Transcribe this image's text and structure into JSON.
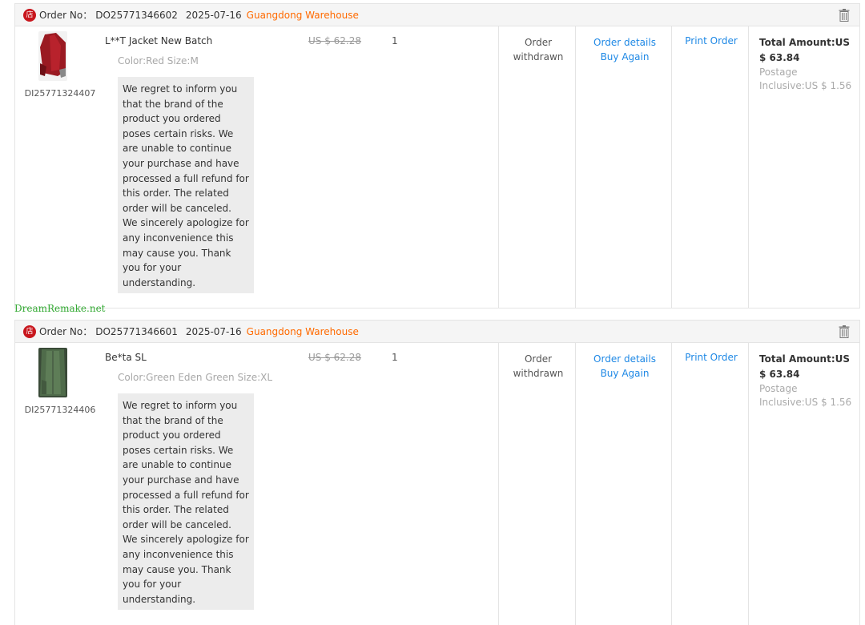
{
  "colors": {
    "warehouse": "#ff6a00",
    "link": "#1e88e5",
    "shop_icon": "#c8161d",
    "watermark": "#33aa33"
  },
  "watermark": "DreamRemake.net",
  "orders": [
    {
      "shop_icon_glyph": "店",
      "order_label": "Order No：",
      "order_no": "DO25771346602",
      "date": "2025-07-16",
      "warehouse": "Guangdong Warehouse",
      "thumb_icon": "red-jacket-icon",
      "item_code": "DI25771324407",
      "product_name": "L**T Jacket New Batch",
      "product_spec": "Color:Red Size:M",
      "refund_note": "We regret to inform you that the brand of the product you ordered poses certain risks. We are unable to continue your purchase and have processed a full refund for this order. The related order will be canceled. We sincerely apologize for any inconvenience this may cause you. Thank you for your understanding.",
      "price": "US $ 62.28",
      "qty": "1",
      "status_line1": "Order",
      "status_line2": "withdrawn",
      "link_details": "Order details",
      "link_buy_again": "Buy Again",
      "print_order": "Print Order",
      "total_label": "Total Amount:US",
      "total_value": "$ 63.84",
      "postage_line1": "Postage",
      "postage_line2": "Inclusive:US $ 1.56"
    },
    {
      "shop_icon_glyph": "店",
      "order_label": "Order No：",
      "order_no": "DO25771346601",
      "date": "2025-07-16",
      "warehouse": "Guangdong Warehouse",
      "thumb_icon": "green-jacket-icon",
      "item_code": "DI25771324406",
      "product_name": "Be*ta SL",
      "product_spec": "Color:Green Eden Green Size:XL",
      "refund_note": "We regret to inform you that the brand of the product you ordered poses certain risks. We are unable to continue your purchase and have processed a full refund for this order. The related order will be canceled. We sincerely apologize for any inconvenience this may cause you. Thank you for your understanding.",
      "price": "US $ 62.28",
      "qty": "1",
      "status_line1": "Order",
      "status_line2": "withdrawn",
      "link_details": "Order details",
      "link_buy_again": "Buy Again",
      "print_order": "Print Order",
      "total_label": "Total Amount:US",
      "total_value": "$ 63.84",
      "postage_line1": "Postage",
      "postage_line2": "Inclusive:US $ 1.56"
    }
  ]
}
